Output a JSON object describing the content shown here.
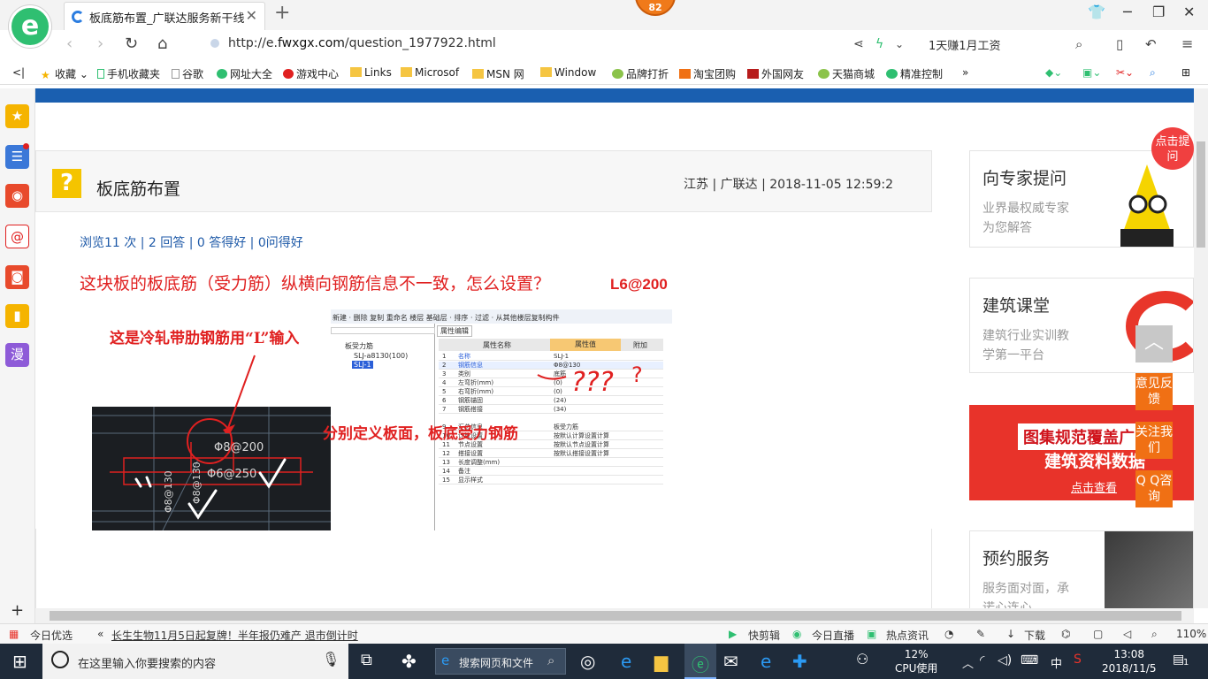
{
  "browser": {
    "tab_title": "板底筋布置_广联达服务新干线",
    "badge": "82",
    "url_prefix": "http://e.",
    "url_domain": "fwxgx.com",
    "url_path": "/question_1977922.html",
    "search_hint": "1天赚1月工资",
    "bookmarks": [
      "收藏",
      "手机收藏夹",
      "谷歌",
      "网址大全",
      "游戏中心",
      "Links",
      "Microsof",
      "MSN 网",
      "Window",
      "品牌打折",
      "淘宝团购",
      "外国网友",
      "天猫商城",
      "精准控制"
    ]
  },
  "question": {
    "title": "板底筋布置",
    "meta": "江苏 | 广联达 | 2018-11-05 12:59:2",
    "stats": "浏览11 次 | 2 回答 | 0 答得好 | 0问得好",
    "text": "这块板的板底筋（受力筋）纵横向钢筋信息不一致，怎么设置？",
    "annotation_l6": "L6@200",
    "annotation_l": "这是冷轧带肋钢筋用“L”输入",
    "annotation_define": "分别定义板面，板底受力钢筋"
  },
  "cad": {
    "t1": "Φ8@200",
    "t2": "Φ6@250",
    "t3": "Φ8@130",
    "t4": "Φ8@130"
  },
  "props": {
    "toolbar": "新建 · 删除 复制 重命名 楼层 基础层 · 排序 · 过滤 · 从其他楼层复制构件",
    "tab": "属性编辑",
    "tree_root": "板受力筋",
    "tree_a": "SLJ-a8130(100)",
    "tree_b": "SLJ-1",
    "h_name": "属性名称",
    "h_value": "属性值",
    "h_add": "附加",
    "rows": [
      {
        "n": "1",
        "k": "名称",
        "v": "SLJ-1"
      },
      {
        "n": "2",
        "k": "钢筋信息",
        "v": "Φ8@130"
      },
      {
        "n": "3",
        "k": "类别",
        "v": "底筋"
      },
      {
        "n": "4",
        "k": "左弯折(mm)",
        "v": "(0)"
      },
      {
        "n": "5",
        "k": "右弯折(mm)",
        "v": "(0)"
      },
      {
        "n": "6",
        "k": "钢筋锚固",
        "v": "(24)"
      },
      {
        "n": "7",
        "k": "钢筋搭接",
        "v": "(34)"
      },
      {
        "n": "9",
        "k": "汇总信息",
        "v": "板受力筋"
      },
      {
        "n": "10",
        "k": "计算设置",
        "v": "按默认计算设置计算"
      },
      {
        "n": "11",
        "k": "节点设置",
        "v": "按默认节点设置计算"
      },
      {
        "n": "12",
        "k": "搭接设置",
        "v": "按默认搭接设置计算"
      },
      {
        "n": "13",
        "k": "长度调整(mm)",
        "v": ""
      },
      {
        "n": "14",
        "k": "备注",
        "v": ""
      },
      {
        "n": "15",
        "k": "显示样式",
        "v": ""
      }
    ]
  },
  "right": {
    "c1_h": "向专家提问",
    "c1_s1": "业界最权威专家",
    "c1_s2": "为您解答",
    "bubble": "点击提问",
    "c2_h": "建筑课堂",
    "c2_s1": "建筑行业实训教",
    "c2_s2": "学第一平台",
    "banner1": "图集规范覆盖广",
    "banner2": "建筑资料数据",
    "banner3": "点击查看",
    "c4_h": "预约服务",
    "c4_s1": "服务面对面，承",
    "c4_s2": "诺心连心"
  },
  "float": {
    "f1": "意见反馈",
    "f2": "关注我们",
    "f3": "Q Q咨询"
  },
  "status": {
    "today": "今日优选",
    "news": "长生生物11月5日起复牌！半年报仍难产 退市倒计时",
    "quick": "快剪辑",
    "live": "今日直播",
    "hot": "热点资讯",
    "download": "下载",
    "zoom": "110%"
  },
  "taskbar": {
    "search": "在这里输入你要搜索的内容",
    "app_search": "搜索网页和文件",
    "cpu_pct": "12%",
    "cpu_label": "CPU使用",
    "ime": "中",
    "time": "13:08",
    "date": "2018/11/5",
    "notif": "1"
  }
}
